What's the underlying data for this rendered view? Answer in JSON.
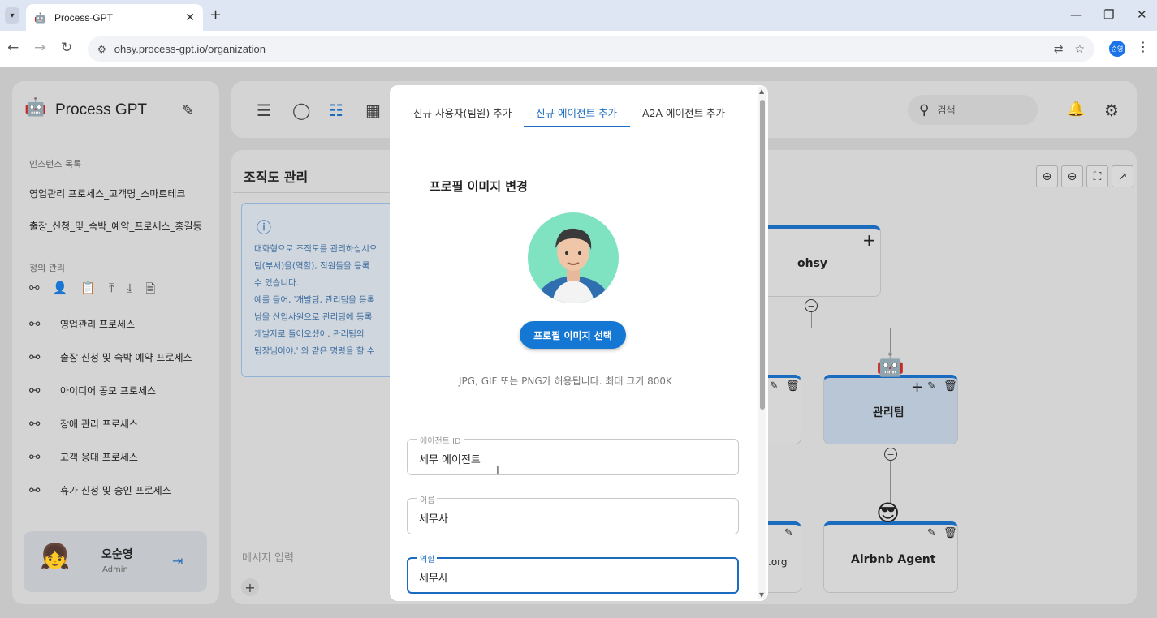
{
  "browser": {
    "tab_title": "Process-GPT",
    "url": "ohsy.process-gpt.io/organization",
    "new_tab": "+",
    "profile_initials": "순영"
  },
  "app": {
    "title": "Process GPT",
    "instances_label": "인스턴스 목록",
    "instances": [
      "영업관리 프로세스_고객명_스마트테크",
      "출장_신청_및_숙박_예약_프로세스_홍길동"
    ],
    "definitions_label": "정의 관리",
    "processes": [
      "영업관리 프로세스",
      "출장 신청 및 숙박 예약 프로세스",
      "아이디어 공모 프로세스",
      "장애 관리 프로세스",
      "고객 응대 프로세스",
      "휴가 신청 및 승인 프로세스"
    ],
    "user": {
      "name": "오순영",
      "role": "Admin"
    },
    "search_placeholder": "검색"
  },
  "chat": {
    "title": "조직도 관리",
    "info_text": "대화형으로 조직도를 관리하십시오\n팀(부서)을(역할), 직원들을 등록\n수 있습니다.\n예를 들어, '개발팀, 관리팀을 등록\n님을 신입사원으로 관리팀에 등록\n개발자로 들어오셨어. 관리팀의\n팀장님이야.' 와 같은 명령을 할 수",
    "message_placeholder": "메시지 입력"
  },
  "org": {
    "root": "ohsy",
    "team": "관리팀",
    "agent": "Airbnb Agent",
    "partial_label": ".org"
  },
  "modal": {
    "tabs": [
      "신규 사용자(팀원) 추가",
      "신규 에이전트 추가",
      "A2A 에이전트 추가"
    ],
    "selected_tab": 1,
    "section_title": "프로필 이미지 변경",
    "select_button": "프로필 이미지 선택",
    "hint": "JPG, GIF 또는 PNG가 허용됩니다. 최대 크기 800K",
    "fields": [
      {
        "label": "에이전트 ID",
        "value": "세무 에이전트"
      },
      {
        "label": "이름",
        "value": "세무사"
      },
      {
        "label": "역할",
        "value": "세무사"
      }
    ]
  },
  "colors": {
    "accent": "#1577d4",
    "node_top": "#1b6cbf",
    "avatar_bg": "#7fe3c1"
  }
}
